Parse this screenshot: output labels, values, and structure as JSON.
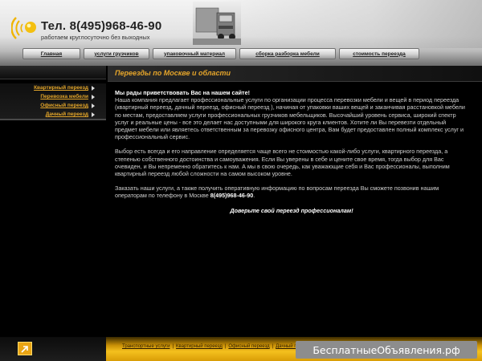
{
  "header": {
    "phone": "Тел. 8(495)968-46-90",
    "slogan": "работаем круглосуточно без выходных"
  },
  "nav": {
    "items": [
      {
        "label": "Главная"
      },
      {
        "label": "услуги грузчиков"
      },
      {
        "label": "упаковочный материал"
      },
      {
        "label": "сборка разборка мебели"
      },
      {
        "label": "стоимость переезда"
      }
    ]
  },
  "sidebar": {
    "items": [
      {
        "label": "Квартирный переезд"
      },
      {
        "label": "Перевозка мебели"
      },
      {
        "label": "Офисный переезд"
      },
      {
        "label": "Дачный переезд"
      }
    ]
  },
  "main": {
    "title": "Переезды по Москве и области",
    "lead": "Мы рады приветствовать Вас на нашем сайте!",
    "paragraph1": "Наша компания предлагает профессиональные услуги по организации процесса перевозки мебели и вещей в период переезда (квартирный переезд, дачный переезд, офисный переезд ), начиная от упаковки ваших вещей и заканчивая расстановкой мебели по местам, предоставляем услуги профессиональных грузчиков мебельщиков. Высочайший уровень сервиса, широкий спектр услуг и реальные цены - все это делает нас доступными для широкого круга клиентов. Хотите ли Вы перевезти отдельный предмет мебели или являетесь ответственным за перевозку офисного центра, Вам будет предоставлен полный комплекс услуг и профессиональный сервис.",
    "paragraph2": "Выбор есть всегда и его направление определяется чаще всего не стоимостью какой-либо услуги, квартирного переезда, а степенью собственного достоинства и самоуважения. Если Вы уверены в себе и цените свое время, тогда выбор для Вас очевиден, и Вы непременно обратитесь к нам. А мы в свою очередь, как уважающие себя и Вас профессионалы, выполним квартирный переезд любой сложности на самом высоком уровне.",
    "paragraph3_prefix": "Заказать наши услуги, а также получить оперативную информацию по вопросам переезда Вы сможете позвонив нашим операторам по телефону в Москве ",
    "paragraph3_phone": "8(495)968-46-90",
    "paragraph3_suffix": ".",
    "tagline": "Доверьте свой переезд профессионалам!"
  },
  "footer": {
    "links": [
      {
        "label": "Транспортные услуги"
      },
      {
        "label": "Квартирный переезд"
      },
      {
        "label": "Офисный переезд"
      },
      {
        "label": "Дачный п..."
      }
    ],
    "separator": "|",
    "watermark": "БесплатныеОбъявления.рф"
  },
  "colors": {
    "accent": "#e5a52a",
    "footer": "#f4c01e"
  }
}
